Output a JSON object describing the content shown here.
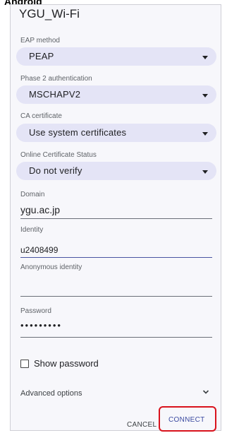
{
  "caption": "Android",
  "dialog": {
    "title": "YGU_Wi-Fi"
  },
  "fields": {
    "eap_method": {
      "label": "EAP method",
      "value": "PEAP"
    },
    "phase2": {
      "label": "Phase 2 authentication",
      "value": "MSCHAPV2"
    },
    "ca_cert": {
      "label": "CA certificate",
      "value": "Use system certificates"
    },
    "ocsp": {
      "label": "Online Certificate Status",
      "value": "Do not verify"
    },
    "domain": {
      "label": "Domain",
      "value": "ygu.ac.jp"
    },
    "identity": {
      "label": "Identity",
      "value": "u2408499"
    },
    "anon_identity": {
      "label": "Anonymous identity",
      "value": ""
    },
    "password": {
      "label": "Password",
      "value": "•••••••••"
    }
  },
  "show_password": {
    "label": "Show password",
    "checked": false
  },
  "advanced": {
    "label": "Advanced options",
    "icon": "chevron-down-icon"
  },
  "buttons": {
    "cancel": "CANCEL",
    "connect": "CONNECT"
  },
  "colors": {
    "dropdown_bg": "#e4e4f6",
    "accent": "#3b4aa0",
    "highlight": "#d9121c"
  }
}
